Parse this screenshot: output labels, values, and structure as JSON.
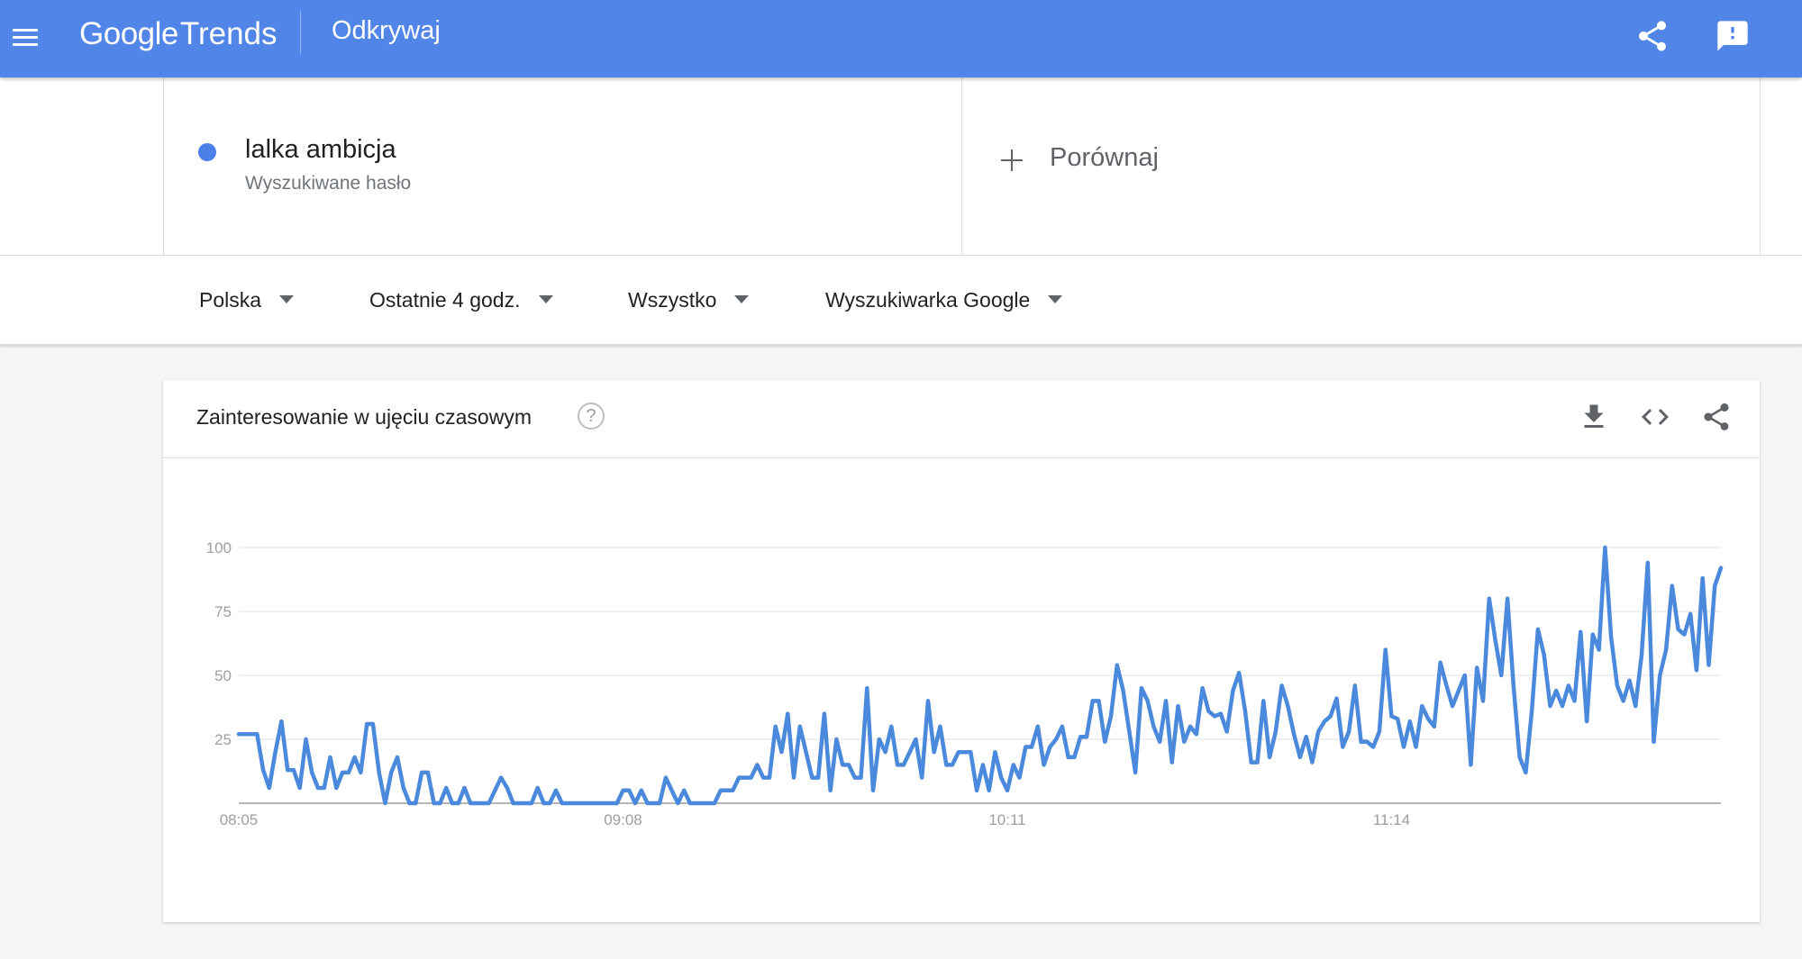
{
  "header": {
    "logo_google": "Google",
    "logo_trends": "Trends",
    "title": "Odkrywaj"
  },
  "term": {
    "name": "lalka ambicja",
    "subtitle": "Wyszukiwane hasło",
    "color": "#4a80e8"
  },
  "compare": {
    "label": "Porównaj"
  },
  "filters": {
    "region": "Polska",
    "time": "Ostatnie 4 godz.",
    "category": "Wszystko",
    "property": "Wyszukiwarka Google"
  },
  "card": {
    "title": "Zainteresowanie w ujęciu czasowym",
    "help": "?"
  },
  "icons": {
    "menu": "menu-icon",
    "share": "share-icon",
    "feedback": "feedback-icon",
    "download": "download-icon",
    "embed": "embed-icon",
    "help": "help-icon"
  },
  "colors": {
    "header": "#5285e8",
    "series": "#4a89dc"
  },
  "chart_data": {
    "type": "line",
    "ylim": [
      0,
      100
    ],
    "yticks": [
      25,
      50,
      75,
      100
    ],
    "x_tick_labels": [
      "08:05",
      "09:08",
      "10:11",
      "11:14"
    ],
    "x_tick_index": [
      0,
      63,
      126,
      189
    ],
    "grid": true,
    "series": [
      {
        "values": [
          27,
          27,
          27,
          27,
          13,
          6,
          20,
          32,
          13,
          13,
          6,
          25,
          12,
          6,
          6,
          18,
          6,
          12,
          12,
          18,
          12,
          31,
          31,
          12,
          0,
          12,
          18,
          6,
          0,
          0,
          12,
          12,
          0,
          0,
          6,
          0,
          0,
          6,
          0,
          0,
          0,
          0,
          5,
          10,
          6,
          0,
          0,
          0,
          0,
          6,
          0,
          0,
          5,
          0,
          0,
          0,
          0,
          0,
          0,
          0,
          0,
          0,
          0,
          5,
          5,
          0,
          5,
          0,
          0,
          0,
          10,
          5,
          0,
          5,
          0,
          0,
          0,
          0,
          0,
          5,
          5,
          5,
          10,
          10,
          10,
          15,
          10,
          10,
          30,
          20,
          35,
          10,
          30,
          20,
          10,
          10,
          35,
          5,
          25,
          15,
          15,
          10,
          10,
          45,
          5,
          25,
          20,
          30,
          15,
          15,
          20,
          25,
          10,
          40,
          20,
          30,
          15,
          15,
          20,
          20,
          20,
          5,
          15,
          5,
          20,
          10,
          5,
          15,
          10,
          22,
          22,
          30,
          15,
          22,
          25,
          30,
          18,
          18,
          26,
          26,
          40,
          40,
          24,
          34,
          54,
          44,
          28,
          12,
          45,
          40,
          30,
          24,
          40,
          16,
          38,
          24,
          30,
          27,
          45,
          36,
          34,
          35,
          28,
          44,
          51,
          36,
          16,
          16,
          40,
          18,
          28,
          46,
          38,
          27,
          18,
          26,
          16,
          28,
          32,
          34,
          41,
          22,
          28,
          46,
          24,
          24,
          22,
          28,
          60,
          34,
          33,
          22,
          32,
          22,
          38,
          33,
          30,
          55,
          46,
          38,
          44,
          50,
          15,
          53,
          40,
          80,
          64,
          50,
          80,
          46,
          18,
          12,
          36,
          68,
          58,
          38,
          44,
          38,
          46,
          40,
          67,
          32,
          66,
          60,
          100,
          65,
          46,
          40,
          48,
          38,
          58,
          94,
          24,
          50,
          60,
          85,
          68,
          66,
          74,
          52,
          88,
          54,
          85,
          92
        ]
      }
    ]
  }
}
